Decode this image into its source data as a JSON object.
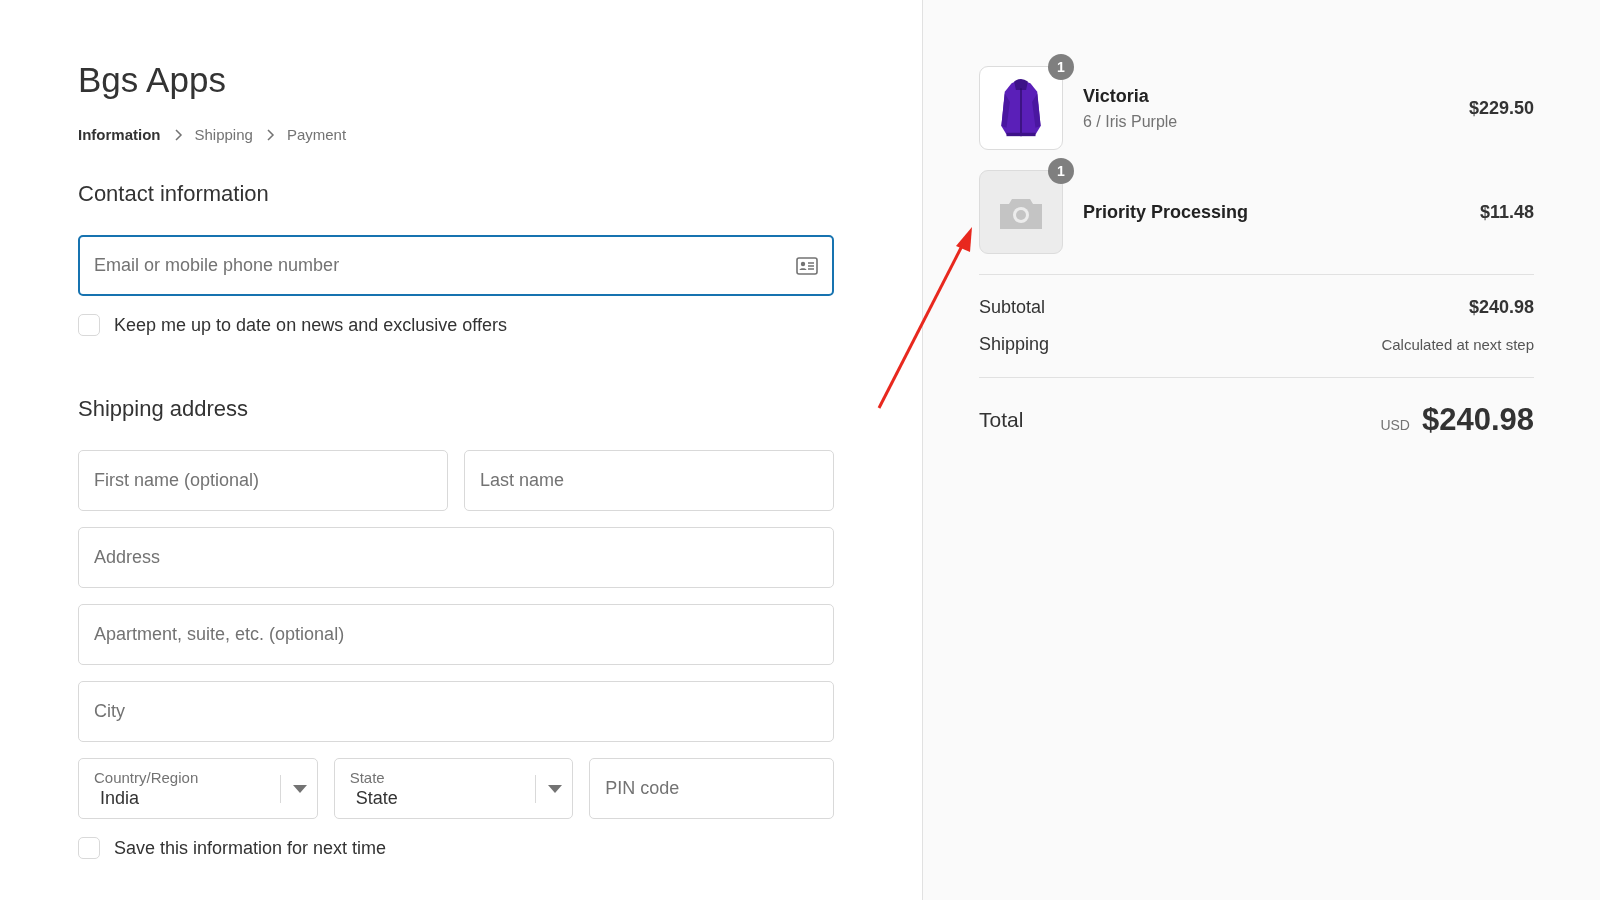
{
  "store_name": "Bgs Apps",
  "breadcrumb": [
    {
      "label": "Information",
      "selected": true
    },
    {
      "label": "Shipping",
      "selected": false
    },
    {
      "label": "Payment",
      "selected": false
    }
  ],
  "contact": {
    "heading": "Contact information",
    "email": {
      "placeholder": "Email or mobile phone number",
      "focused": true
    },
    "newsletter": {
      "label": "Keep me up to date on news and exclusive offers",
      "checked": false
    }
  },
  "shipping_address": {
    "heading": "Shipping address",
    "rows": [
      [
        {
          "kind": "input",
          "placeholder": "First name (optional)"
        },
        {
          "kind": "input",
          "placeholder": "Last name"
        }
      ],
      [
        {
          "kind": "input",
          "placeholder": "Address"
        }
      ],
      [
        {
          "kind": "input",
          "placeholder": "Apartment, suite, etc. (optional)"
        }
      ],
      [
        {
          "kind": "input",
          "placeholder": "City"
        }
      ],
      [
        {
          "kind": "select",
          "label": "Country/Region",
          "value": "India"
        },
        {
          "kind": "select",
          "label": "State",
          "value": "State"
        },
        {
          "kind": "input",
          "placeholder": "PIN code"
        }
      ]
    ],
    "save": {
      "label": "Save this information for next time",
      "checked": false
    }
  },
  "order_summary": {
    "items": [
      {
        "kind": "picture",
        "quantity": "1",
        "name": "Victoria",
        "variant": "6 / Iris Purple",
        "price": "$229.50"
      },
      {
        "kind": "placeholder",
        "quantity": "1",
        "name": "Priority Processing",
        "price": "$11.48"
      }
    ],
    "subtotal": {
      "label": "Subtotal",
      "value": "$240.98"
    },
    "shipping": {
      "label": "Shipping",
      "value": "Calculated at next step"
    },
    "total": {
      "label": "Total",
      "currency": "USD",
      "value": "$240.98"
    }
  }
}
